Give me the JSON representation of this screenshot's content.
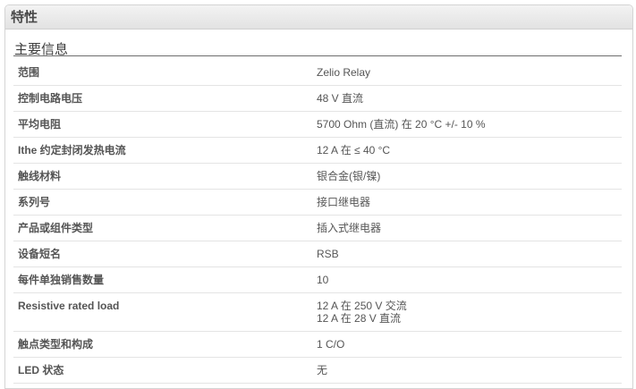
{
  "panel": {
    "title": "特性"
  },
  "section": {
    "title": "主要信息"
  },
  "rows": [
    {
      "label": "范围",
      "value": [
        "Zelio Relay"
      ]
    },
    {
      "label": "控制电路电压",
      "value": [
        "48 V 直流"
      ]
    },
    {
      "label": "平均电阻",
      "value": [
        "5700 Ohm (直流) 在 20 °C +/- 10 %"
      ]
    },
    {
      "label": "Ithe 约定封闭发热电流",
      "value": [
        "12 A 在 ≤ 40 °C"
      ]
    },
    {
      "label": "触线材料",
      "value": [
        "银合金(银/镍)"
      ]
    },
    {
      "label": "系列号",
      "value": [
        "接口继电器"
      ]
    },
    {
      "label": "产品或组件类型",
      "value": [
        "插入式继电器"
      ]
    },
    {
      "label": "设备短名",
      "value": [
        "RSB"
      ]
    },
    {
      "label": "每件单独销售数量",
      "value": [
        "10"
      ]
    },
    {
      "label": "Resistive rated load",
      "value": [
        "12 A 在 250 V 交流",
        "12 A 在 28 V 直流"
      ]
    },
    {
      "label": "触点类型和构成",
      "value": [
        "1 C/O"
      ]
    },
    {
      "label": "LED 状态",
      "value": [
        "无"
      ]
    }
  ]
}
